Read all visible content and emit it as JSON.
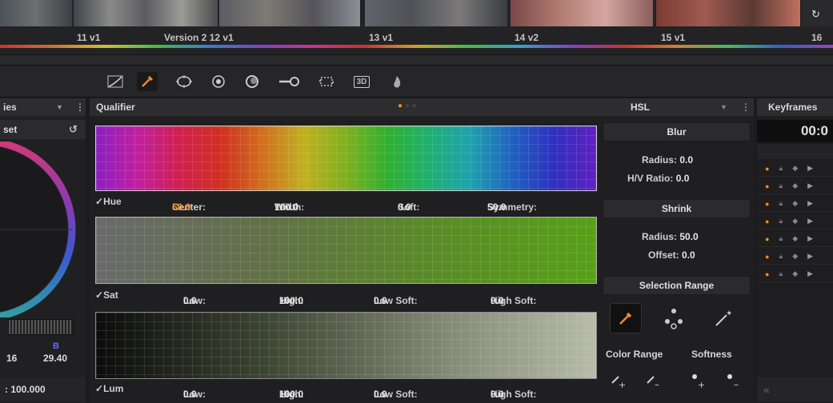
{
  "clips": [
    {
      "num": "11",
      "ver": "v1"
    },
    {
      "extra": "Version 2",
      "num": "12",
      "ver": "v1"
    },
    {
      "num": "13",
      "ver": "v1"
    },
    {
      "num": "14",
      "ver": "v2"
    },
    {
      "num": "15",
      "ver": "v1"
    },
    {
      "num": "16",
      "ver": ""
    }
  ],
  "toolbar": {
    "icons": [
      "curves-icon",
      "qualifier-eyedropper-icon",
      "window-icon",
      "tracker-icon",
      "blur-icon",
      "key-icon",
      "sizing-icon",
      "3d-icon",
      "fire-icon"
    ],
    "three_d": "3D"
  },
  "left_panel": {
    "header": "ies",
    "preset": "set",
    "b_label": "B",
    "b_value": "29.40",
    "left_value": "16",
    "bottom_value": ": 100.000"
  },
  "qualifier": {
    "title": "Qualifier",
    "mode": "HSL",
    "hue": {
      "label": "Hue",
      "center_label": "Center:",
      "center": "50.0",
      "width_label": "Width:",
      "width": "100.0",
      "soft_label": "Soft:",
      "soft": "0.0",
      "symmetry_label": "Symmetry:",
      "symmetry": "50.0"
    },
    "sat": {
      "label": "Sat",
      "low_label": "Low:",
      "low": "0.0",
      "high_label": "High:",
      "high": "100.0",
      "lowsoft_label": "Low Soft:",
      "lowsoft": "0.0",
      "highsoft_label": "High Soft:",
      "highsoft": "0.0"
    },
    "lum": {
      "label": "Lum",
      "low_label": "Low:",
      "low": "0.0",
      "high_label": "High:",
      "high": "100.0",
      "lowsoft_label": "Low Soft:",
      "lowsoft": "0.0",
      "highsoft_label": "High Soft:",
      "highsoft": "0.0"
    }
  },
  "side": {
    "blur": "Blur",
    "radius_label": "Radius:",
    "radius": "0.0",
    "hv_label": "H/V Ratio:",
    "hv": "0.0",
    "shrink": "Shrink",
    "s_radius_label": "Radius:",
    "s_radius": "50.0",
    "offset_label": "Offset:",
    "offset": "0.0",
    "selection": "Selection Range",
    "color_range": "Color Range",
    "softness": "Softness"
  },
  "keyframes": {
    "title": "Keyframes",
    "timecode": "00:0"
  },
  "colors": {
    "accent": "#f08a24"
  }
}
